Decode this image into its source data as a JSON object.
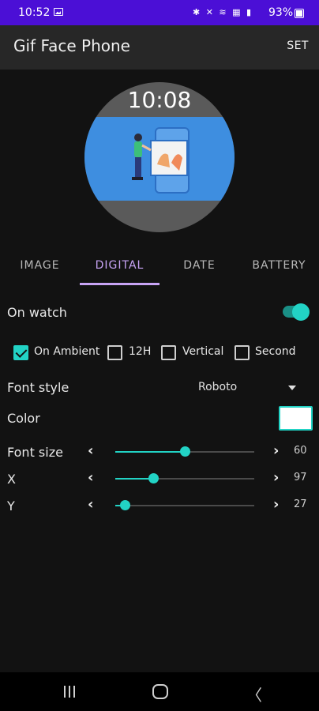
{
  "status": {
    "time": "10:52",
    "icons": "✱ ✕ ≋ ▦ ▮",
    "battery": "93%"
  },
  "app_bar": {
    "title": "Gif Face Phone",
    "action": "SET"
  },
  "watch": {
    "time": "10:08"
  },
  "tabs": [
    {
      "label": "IMAGE",
      "active": false
    },
    {
      "label": "DIGITAL",
      "active": true
    },
    {
      "label": "DATE",
      "active": false
    },
    {
      "label": "BATTERY",
      "active": false
    }
  ],
  "on_watch": {
    "label": "On watch",
    "enabled": true
  },
  "options": [
    {
      "label": "On Ambient",
      "checked": true
    },
    {
      "label": "12H",
      "checked": false
    },
    {
      "label": "Vertical",
      "checked": false
    },
    {
      "label": "Second",
      "checked": false
    }
  ],
  "font_style": {
    "label": "Font style",
    "value": "Roboto"
  },
  "color": {
    "label": "Color",
    "value": "#ffffff"
  },
  "sliders": [
    {
      "label": "Font size",
      "value": "60",
      "fraction": 0.5
    },
    {
      "label": "X",
      "value": "97",
      "fraction": 0.27
    },
    {
      "label": "Y",
      "value": "27",
      "fraction": 0.07
    }
  ],
  "colors": {
    "accent": "#22d3c5",
    "tab_active": "#c8a4f5",
    "status_bar": "#4b0fd6",
    "app_bar": "#272727",
    "background": "#121212"
  },
  "icons": {
    "prev": "‹",
    "next": "›",
    "nav_back": "〈",
    "dropdown": "arrow-drop-down-icon"
  }
}
